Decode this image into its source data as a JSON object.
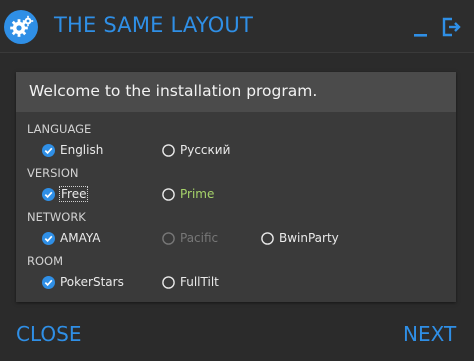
{
  "window": {
    "title": "THE SAME LAYOUT",
    "icon": "gears-icon",
    "accent_color": "#2f8fe6"
  },
  "panel": {
    "heading": "Welcome to the installation program.",
    "sections": [
      {
        "label": "LANGUAGE",
        "options": [
          {
            "label": "English",
            "checked": true,
            "enabled": true
          },
          {
            "label": "Русский",
            "checked": false,
            "enabled": true
          }
        ]
      },
      {
        "label": "VERSION",
        "options": [
          {
            "label": "Free",
            "checked": true,
            "enabled": true
          },
          {
            "label": "Prime",
            "checked": false,
            "enabled": true
          }
        ]
      },
      {
        "label": "NETWORK",
        "options": [
          {
            "label": "AMAYA",
            "checked": true,
            "enabled": true
          },
          {
            "label": "Pacific",
            "checked": false,
            "enabled": false
          },
          {
            "label": "BwinParty",
            "checked": false,
            "enabled": true
          }
        ]
      },
      {
        "label": "ROOM",
        "options": [
          {
            "label": "PokerStars",
            "checked": true,
            "enabled": true
          },
          {
            "label": "FullTilt",
            "checked": false,
            "enabled": true
          }
        ]
      }
    ]
  },
  "footer": {
    "close_label": "CLOSE",
    "next_label": "NEXT"
  }
}
